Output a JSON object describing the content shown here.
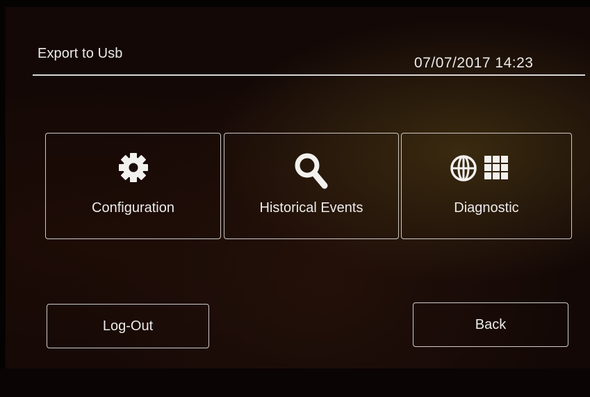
{
  "header": {
    "title": "Export to Usb",
    "datetime": "07/07/2017 14:23"
  },
  "tiles": [
    {
      "label": "Configuration",
      "icon": "gear-icon"
    },
    {
      "label": "Historical Events",
      "icon": "magnifier-icon"
    },
    {
      "label": "Diagnostic",
      "icon": "globe-grid-icon"
    }
  ],
  "buttons": {
    "logout": "Log-Out",
    "back": "Back"
  },
  "colors": {
    "text": "#ecebe8",
    "border": "#cfcac4",
    "background": "#130806"
  }
}
